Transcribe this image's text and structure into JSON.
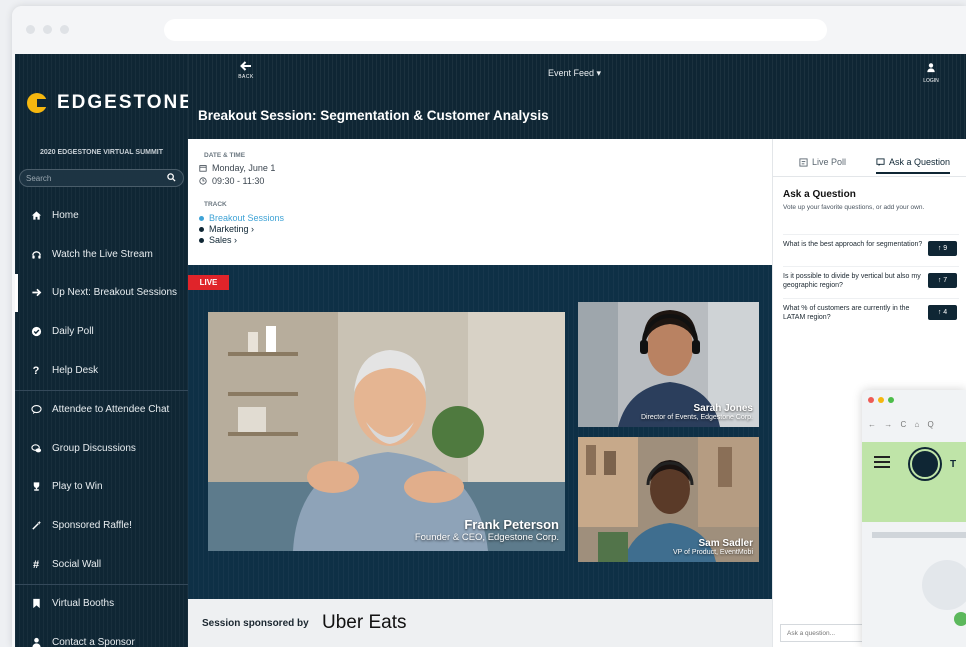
{
  "sidebar": {
    "brand": "EDGESTONE",
    "summit": "2020 EDGESTONE VIRTUAL SUMMIT",
    "search_placeholder": "Search",
    "items": [
      {
        "label": "Home",
        "icon": "home-icon"
      },
      {
        "label": "Watch the Live Stream",
        "icon": "headset-icon"
      },
      {
        "label": "Up Next: Breakout Sessions",
        "icon": "arrow-right-icon",
        "active": true
      },
      {
        "label": "Daily Poll",
        "icon": "check-circle-icon"
      },
      {
        "label": "Help Desk",
        "icon": "question-icon"
      },
      {
        "label": "Attendee to Attendee Chat",
        "icon": "chat-bubble-icon"
      },
      {
        "label": "Group Discussions",
        "icon": "group-chat-icon"
      },
      {
        "label": "Play to Win",
        "icon": "trophy-icon"
      },
      {
        "label": "Sponsored Raffle!",
        "icon": "magic-wand-icon"
      },
      {
        "label": "Social Wall",
        "icon": "hashtag-icon"
      },
      {
        "label": "Virtual Booths",
        "icon": "bookmark-icon"
      },
      {
        "label": "Contact a Sponsor",
        "icon": "user-icon"
      }
    ]
  },
  "topbar": {
    "back_label": "BACK",
    "feed_label": "Event Feed ▾",
    "login_label": "LOGIN",
    "session_title": "Breakout Session: Segmentation & Customer Analysis"
  },
  "details": {
    "date_heading": "DATE & TIME",
    "date": "Monday, June 1",
    "time": "09:30 - 11:30",
    "track_heading": "TRACK",
    "tracks": [
      {
        "label": "Breakout Sessions",
        "color": "#3fa3d6"
      },
      {
        "label": "Marketing ›",
        "color": "#0f2634"
      },
      {
        "label": "Sales ›",
        "color": "#0f2634"
      }
    ]
  },
  "stage": {
    "live_label": "LIVE",
    "speakers": [
      {
        "name": "Frank Peterson",
        "title": "Founder & CEO, Edgestone Corp."
      },
      {
        "name": "Sarah Jones",
        "title": "Director of Events, Edgestone Corp."
      },
      {
        "name": "Sam Sadler",
        "title": "VP of Product, EventMobi"
      }
    ]
  },
  "sponsor": {
    "prefix": "Session sponsored by",
    "logo_text": "Uber Eats"
  },
  "qa": {
    "tab_poll": "Live Poll",
    "tab_ask": "Ask a Question",
    "title": "Ask a Question",
    "subtitle": "Vote up your favorite questions, or add your own.",
    "questions": [
      {
        "text": "What is the best approach for segmentation?",
        "votes": "9"
      },
      {
        "text": "Is it possible to divide by vertical but also my geographic region?",
        "votes": "7"
      },
      {
        "text": "What % of customers are currently in the LATAM region?",
        "votes": "4"
      }
    ],
    "input_placeholder": "Ask a question..."
  },
  "mini_window": {
    "nav_text": "← → C ⌂ Q",
    "label_fragment": "T"
  },
  "colors": {
    "navy": "#0f2634",
    "accent": "#f5b70f",
    "live": "#e0242a"
  }
}
